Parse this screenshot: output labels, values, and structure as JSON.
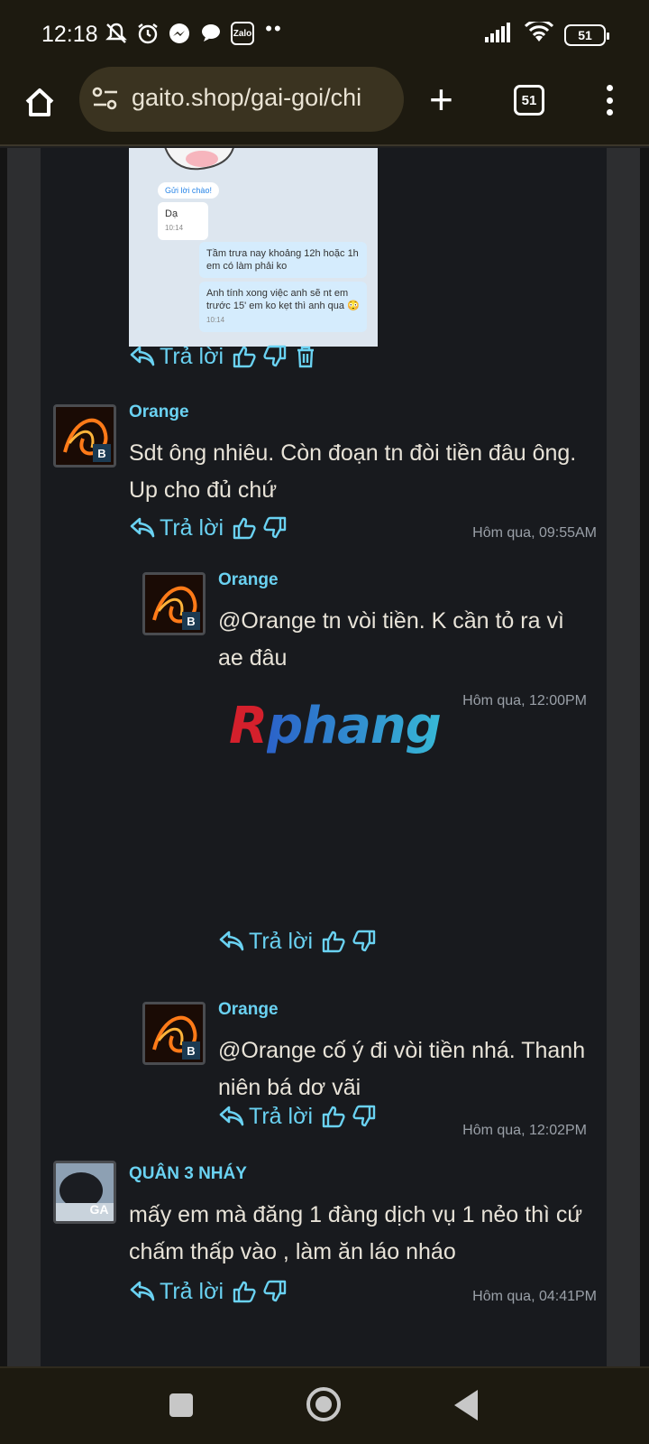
{
  "status": {
    "time": "12:18",
    "icons": [
      "mute-bell-icon",
      "alarm-icon",
      "messenger-icon",
      "chat-icon",
      "zalo-icon",
      "more-dots-icon"
    ],
    "zalo_label": "Zalo",
    "dots": "••",
    "battery": "51"
  },
  "browser": {
    "url": "gaito.shop/gai-goi/chi",
    "tab_count": "51"
  },
  "chat_image": {
    "greeting": "Gửi lời chào!",
    "messages": [
      {
        "text": "Dạ",
        "time": "10:14"
      },
      {
        "text": "Tầm trưa nay khoảng 12h hoặc 1h em có làm phải ko",
        "time": ""
      },
      {
        "text": "Anh tính xong việc anh sẽ nt em trước 15' em ko kẹt thì anh qua 😳",
        "time": "10:14"
      }
    ]
  },
  "reply_label": "Trả lời",
  "posts": [
    {
      "user": "Orange",
      "badge": "B",
      "text": "Sdt ông nhiêu. Còn đoạn tn đòi tiền đâu ông. Up cho đủ chứ",
      "time": "Hôm qua, 09:55AM"
    },
    {
      "user": "Orange",
      "badge": "B",
      "text": "@Orange tn vòi tiền. K cần tỏ ra vì ae đâu",
      "time": "Hôm qua, 12:00PM"
    },
    {
      "user": "Orange",
      "badge": "B",
      "text": "@Orange cố ý đi vòi tiền nhá. Thanh niên bá dơ vãi",
      "time": "Hôm qua, 12:02PM"
    },
    {
      "user": "QUÂN 3 NHÁY",
      "badge": "GA",
      "text": "mấy em mà đăng 1 đàng dịch vụ 1 nẻo thì cứ chấm thấp vào , làm ăn láo nháo",
      "time": "Hôm qua, 04:41PM"
    }
  ],
  "watermark": {
    "part1": "R",
    "part2": "phang"
  },
  "colors": {
    "accent": "#6ad2f2",
    "text": "#e8e3d8",
    "panel": "#181a1e",
    "bar": "#1d1a10"
  }
}
